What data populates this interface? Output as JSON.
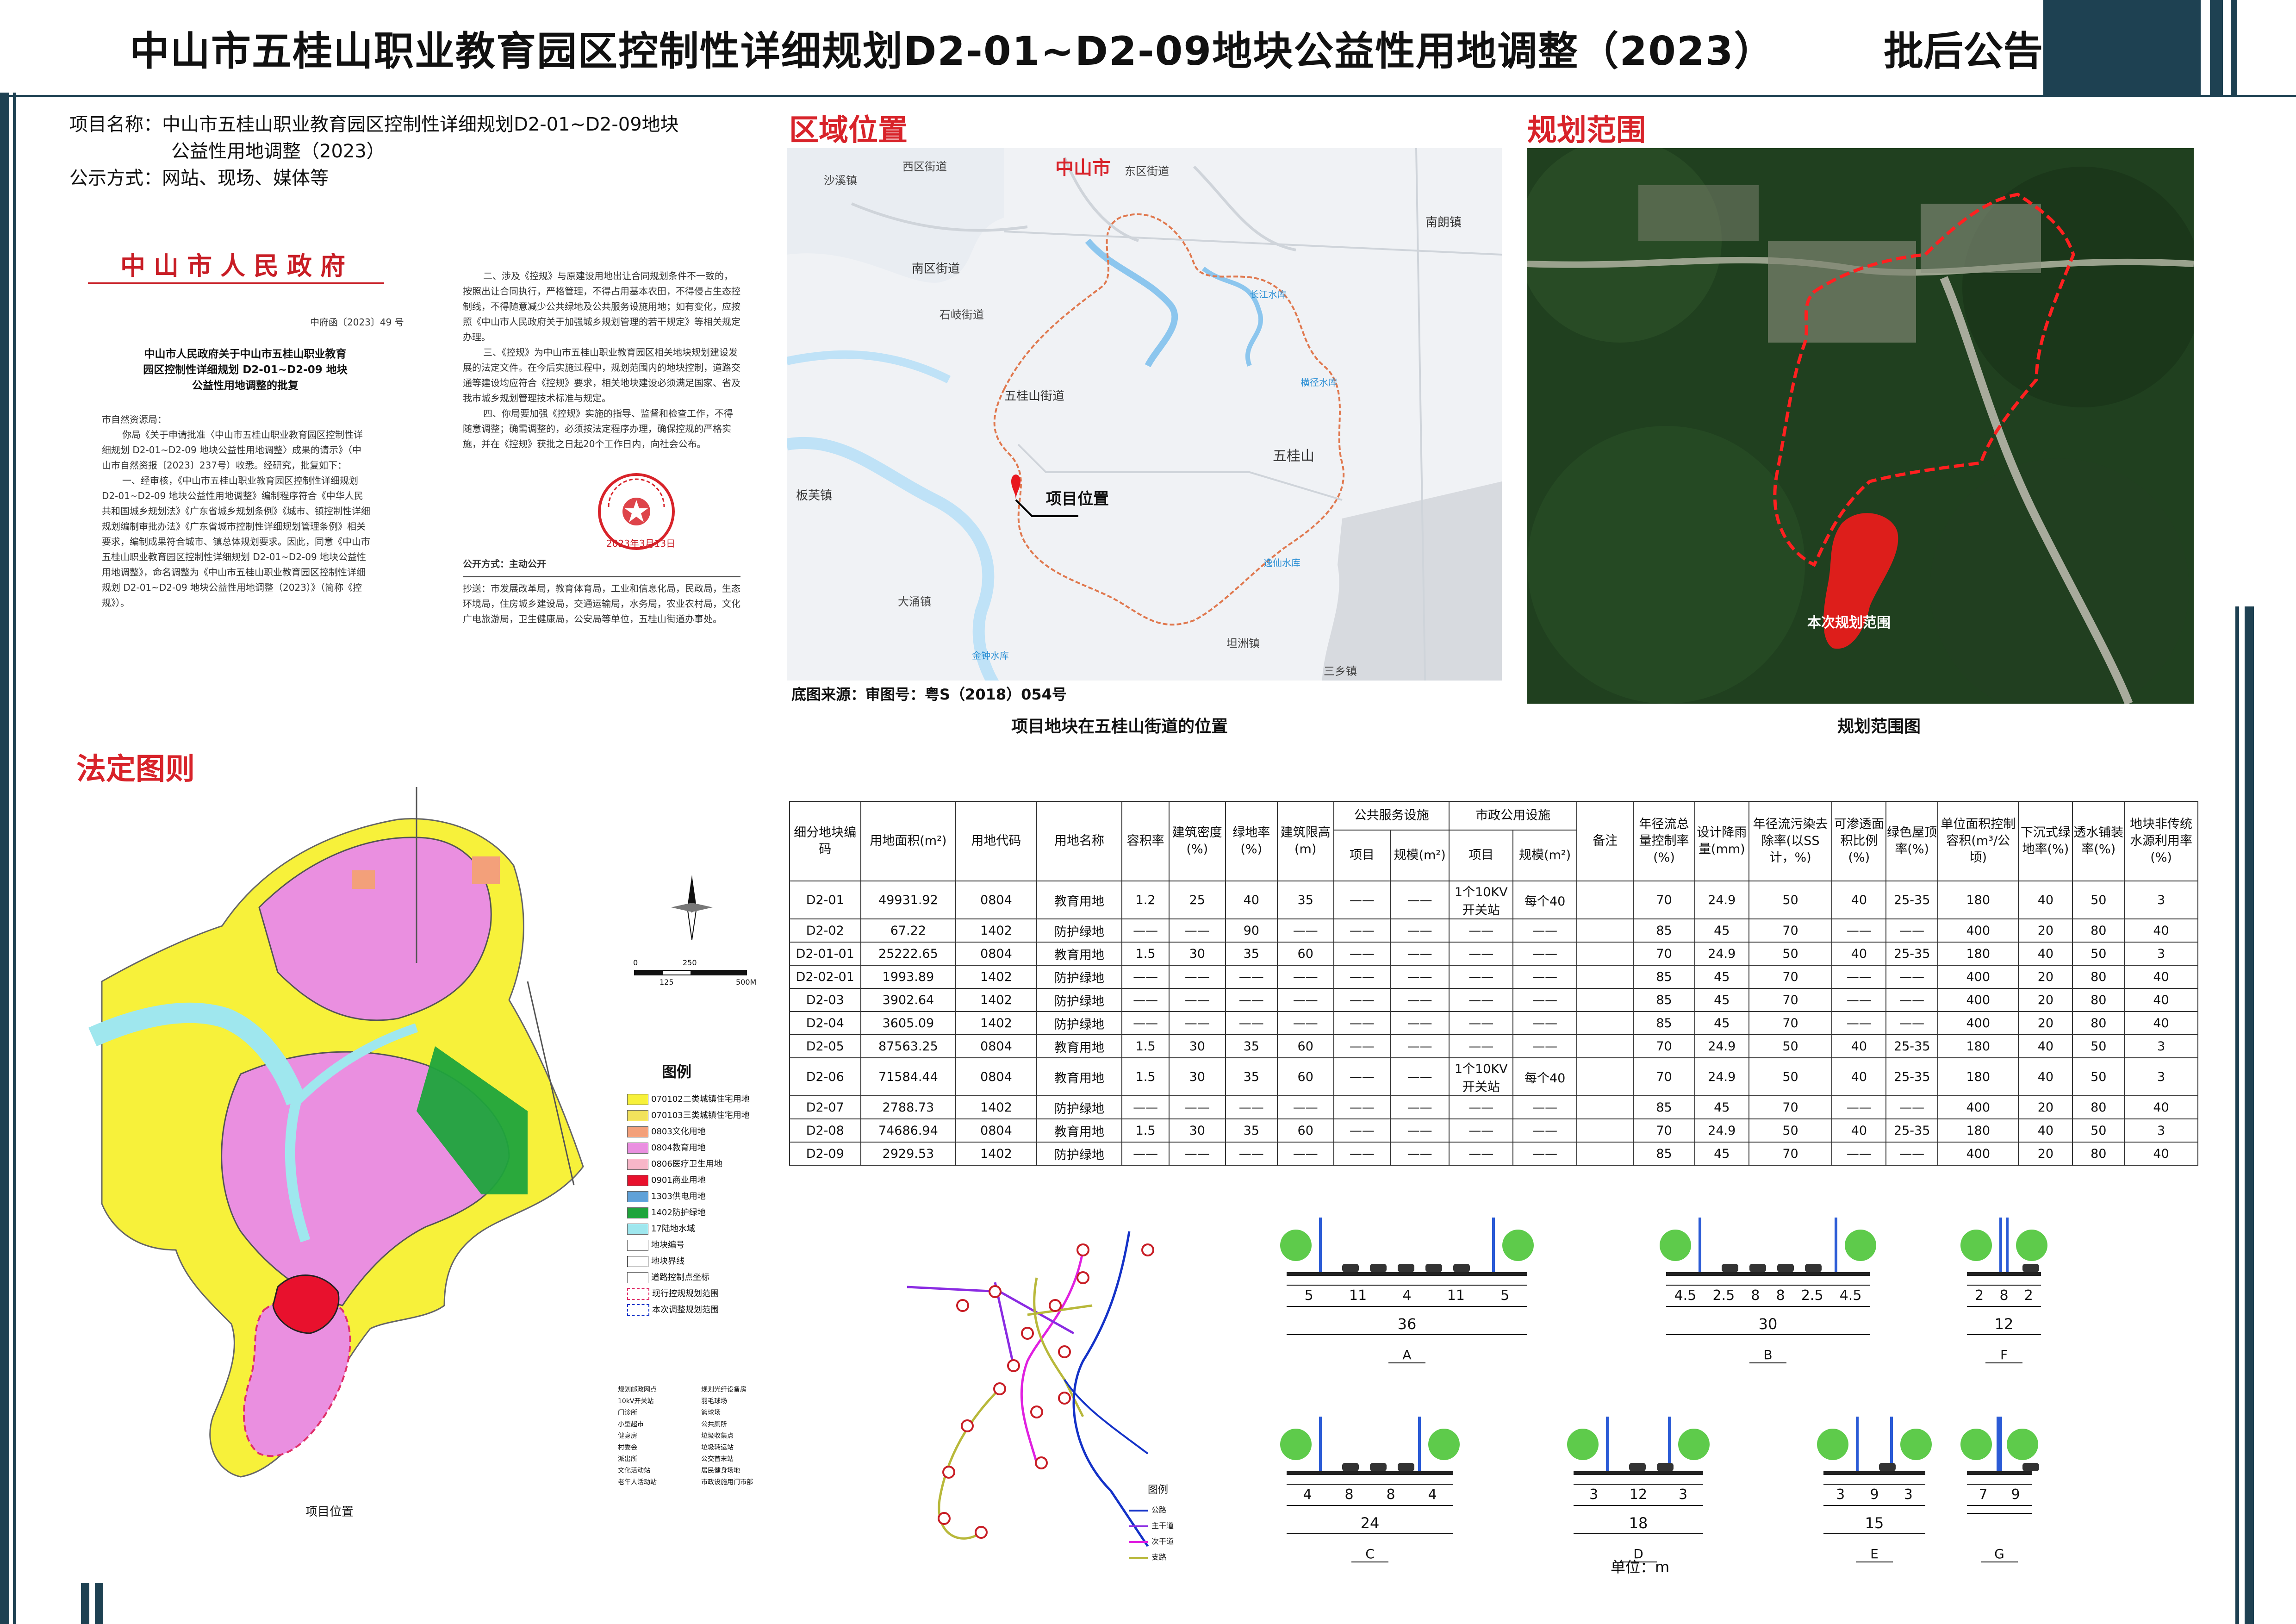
{
  "header": {
    "title": "中山市五桂山职业教育园区控制性详细规划D2-01~D2-09地块公益性用地调整（2023）",
    "notice": "批后公告"
  },
  "project": {
    "name_label": "项目名称：",
    "name_line1": "中山市五桂山职业教育园区控制性详细规划D2-01~D2-09地块",
    "name_line2": "公益性用地调整（2023）",
    "method_label": "公示方式：",
    "method": "网站、现场、媒体等"
  },
  "document": {
    "gov_title": "中山市人民政府",
    "doc_number": "中府函〔2023〕49 号",
    "doc_heading_1": "中山市人民政府关于中山市五桂山职业教育",
    "doc_heading_2": "园区控制性详细规划 D2-01~D2-09 地块",
    "doc_heading_3": "公益性用地调整的批复",
    "addressee": "市自然资源局：",
    "para1": "你局《关于申请批准〈中山市五桂山职业教育园区控制性详细规划 D2-01~D2-09 地块公益性用地调整〉成果的请示》（中山市自然资报〔2023〕237号）收悉。经研究，批复如下：",
    "para2": "一、经审核，《中山市五桂山职业教育园区控制性详细规划 D2-01~D2-09 地块公益性用地调整》编制程序符合《中华人民共和国城乡规划法》《广东省城乡规划条例》《城市、镇控制性详细规划编制审批办法》《广东省城市控制性详细规划管理条例》相关要求，编制成果符合城市、镇总体规划要求。因此，同意《中山市五桂山职业教育园区控制性详细规划 D2-01~D2-09 地块公益性用地调整》，命名调整为《中山市五桂山职业教育园区控制性详细规划 D2-01~D2-09 地块公益性用地调整（2023）》（简称《控规》）。",
    "para3": "二、涉及《控规》与原建设用地出让合同规划条件不一致的，按照出让合同执行，严格管理，不得占用基本农田，不得侵占生态控制线，不得随意减少公共绿地及公共服务设施用地；如有变化，应按照《中山市人民政府关于加强城乡规划管理的若干规定》等相关规定办理。",
    "para4": "三、《控规》为中山市五桂山职业教育园区相关地块规划建设发展的法定文件。在今后实施过程中，规划范围内的地块控制，道路交通等建设均应符合《控规》要求，相关地块建设必须满足国家、省及我市城乡规划管理技术标准与规定。",
    "para5": "四、你局要加强《控规》实施的指导、监督和检查工作，不得随意调整；确需调整的，必须按法定程序办理，确保控规的严格实施，并在《控规》获批之日起20个工作日内，向社会公布。",
    "seal_date": "2023年3月13日",
    "public_label": "公开方式：主动公开",
    "cc_label": "抄送：",
    "cc": "市发展改革局，教育体育局，工业和信息化局，民政局，生态环境局，住房城乡建设局，交通运输局，水务局，农业农村局，文化广电旅游局，卫生健康局，公安局等单位，五桂山街道办事处。"
  },
  "location": {
    "title": "区域位置",
    "caption": "项目地块在五桂山街道的位置",
    "source": "底图来源：审图号：粤S（2018）054号",
    "city_label": "中山市",
    "project_label": "项目位置",
    "labels": [
      "西区街道",
      "东区街道",
      "石岐街道",
      "沙溪镇",
      "南区街道",
      "五桂山街道",
      "南朗镇",
      "板芙镇",
      "大涌镇",
      "坦洲镇",
      "三乡镇",
      "五桂山",
      "长江水库",
      "金钟水库",
      "逸仙水库",
      "横径水库"
    ]
  },
  "scope": {
    "title": "规划范围",
    "caption": "规划范围图",
    "area_label": "本次规划范围"
  },
  "statutory": {
    "title": "法定图则",
    "project_label": "项目位置",
    "legend_title": "图例",
    "legend": [
      {
        "label": "070102二类城镇住宅用地",
        "color": "#f7f13a"
      },
      {
        "label": "070103三类城镇住宅用地",
        "color": "#f2e25c"
      },
      {
        "label": "0803文化用地",
        "color": "#f3a07a"
      },
      {
        "label": "0804教育用地",
        "color": "#ea8fe0"
      },
      {
        "label": "0806医疗卫生用地",
        "color": "#f7b6c8"
      },
      {
        "label": "0901商业用地",
        "color": "#e8112d"
      },
      {
        "label": "1303供电用地",
        "color": "#5fa1d8"
      },
      {
        "label": "1402防护绿地",
        "color": "#1fa43c"
      },
      {
        "label": "17陆地水域",
        "color": "#9fe7ee"
      },
      {
        "label": "地块编号",
        "color": "#ffffff"
      },
      {
        "label": "地块界线",
        "color": "#ffffff"
      },
      {
        "label": "道路控制点坐标",
        "color": "#ffffff"
      },
      {
        "label": "现行控规规划范围",
        "color": "#ffffff"
      },
      {
        "label": "本次调整规划范围",
        "color": "#ffffff"
      }
    ],
    "facilities": [
      "规划邮政网点",
      "10kV开关站",
      "门诊所",
      "小型超市",
      "健身房",
      "村委会",
      "派出所",
      "文化活动站",
      "老年人活动站",
      "规划光纤设备房",
      "羽毛球场",
      "篮球场",
      "公共厕所",
      "垃圾收集点",
      "垃圾转运站",
      "公交首末站",
      "居民健身场地",
      "市政设施用门市部"
    ],
    "scale_ticks": [
      "0",
      "125",
      "250",
      "500M"
    ]
  },
  "table": {
    "headers": {
      "code": "细分地块编码",
      "area": "用地面积(m²)",
      "usecode": "用地代码",
      "usename": "用地名称",
      "far": "容积率",
      "density": "建筑密度(%)",
      "green": "绿地率(%)",
      "height": "建筑限高(m)",
      "public": "公共服务设施",
      "municipal": "市政公用设施",
      "item": "项目",
      "scale": "规模(m²)",
      "note": "备注",
      "runoff": "年径流总量控制率(%)",
      "rain": "设计降雨量(mm)",
      "pollute": "年径流污染去除率(以SS计，%)",
      "permeable": "可渗透面积比例(%)",
      "roof": "绿色屋顶率(%)",
      "volume": "单位面积控制容积(m³/公顷)",
      "sunken": "下沉式绿地率(%)",
      "paving": "透水铺装率(%)",
      "nonconv": "地块非传统水源利用率(%)"
    },
    "rows": [
      [
        "D2-01",
        "49931.92",
        "0804",
        "教育用地",
        "1.2",
        "25",
        "40",
        "35",
        "——",
        "——",
        "1个10KV开关站",
        "每个40",
        "",
        "70",
        "24.9",
        "50",
        "40",
        "25-35",
        "180",
        "40",
        "50",
        "3"
      ],
      [
        "D2-02",
        "67.22",
        "1402",
        "防护绿地",
        "——",
        "——",
        "90",
        "——",
        "——",
        "——",
        "——",
        "——",
        "",
        "85",
        "45",
        "70",
        "——",
        "——",
        "400",
        "20",
        "80",
        "40"
      ],
      [
        "D2-01-01",
        "25222.65",
        "0804",
        "教育用地",
        "1.5",
        "30",
        "35",
        "60",
        "——",
        "——",
        "——",
        "——",
        "",
        "70",
        "24.9",
        "50",
        "40",
        "25-35",
        "180",
        "40",
        "50",
        "3"
      ],
      [
        "D2-02-01",
        "1993.89",
        "1402",
        "防护绿地",
        "——",
        "——",
        "——",
        "——",
        "——",
        "——",
        "——",
        "——",
        "",
        "85",
        "45",
        "70",
        "——",
        "——",
        "400",
        "20",
        "80",
        "40"
      ],
      [
        "D2-03",
        "3902.64",
        "1402",
        "防护绿地",
        "——",
        "——",
        "——",
        "——",
        "——",
        "——",
        "——",
        "——",
        "",
        "85",
        "45",
        "70",
        "——",
        "——",
        "400",
        "20",
        "80",
        "40"
      ],
      [
        "D2-04",
        "3605.09",
        "1402",
        "防护绿地",
        "——",
        "——",
        "——",
        "——",
        "——",
        "——",
        "——",
        "——",
        "",
        "85",
        "45",
        "70",
        "——",
        "——",
        "400",
        "20",
        "80",
        "40"
      ],
      [
        "D2-05",
        "87563.25",
        "0804",
        "教育用地",
        "1.5",
        "30",
        "35",
        "60",
        "——",
        "——",
        "——",
        "——",
        "",
        "70",
        "24.9",
        "50",
        "40",
        "25-35",
        "180",
        "40",
        "50",
        "3"
      ],
      [
        "D2-06",
        "71584.44",
        "0804",
        "教育用地",
        "1.5",
        "30",
        "35",
        "60",
        "——",
        "——",
        "1个10KV开关站",
        "每个40",
        "",
        "70",
        "24.9",
        "50",
        "40",
        "25-35",
        "180",
        "40",
        "50",
        "3"
      ],
      [
        "D2-07",
        "2788.73",
        "1402",
        "防护绿地",
        "——",
        "——",
        "——",
        "——",
        "——",
        "——",
        "——",
        "——",
        "",
        "85",
        "45",
        "70",
        "——",
        "——",
        "400",
        "20",
        "80",
        "40"
      ],
      [
        "D2-08",
        "74686.94",
        "0804",
        "教育用地",
        "1.5",
        "30",
        "35",
        "60",
        "——",
        "——",
        "——",
        "——",
        "",
        "70",
        "24.9",
        "50",
        "40",
        "25-35",
        "180",
        "40",
        "50",
        "3"
      ],
      [
        "D2-09",
        "2929.53",
        "1402",
        "防护绿地",
        "——",
        "——",
        "——",
        "——",
        "——",
        "——",
        "——",
        "——",
        "",
        "85",
        "45",
        "70",
        "——",
        "——",
        "400",
        "20",
        "80",
        "40"
      ]
    ]
  },
  "roads": {
    "unit": "单位：m",
    "legend_title": "图例",
    "legend": [
      {
        "label": "公路",
        "color": "#1432c8"
      },
      {
        "label": "主干道",
        "color": "#8a2be2"
      },
      {
        "label": "次干道",
        "color": "#e020e0"
      },
      {
        "label": "支路",
        "color": "#b8b83a"
      }
    ],
    "sections": [
      {
        "name": "A",
        "dims": [
          "5",
          "11",
          "4",
          "11",
          "5"
        ],
        "total": "36"
      },
      {
        "name": "B",
        "dims": [
          "4.5",
          "2.5",
          "8",
          "8",
          "2.5",
          "4.5"
        ],
        "total": "30"
      },
      {
        "name": "F",
        "dims": [
          "2",
          "8",
          "2"
        ],
        "total": "12"
      },
      {
        "name": "C",
        "dims": [
          "4",
          "8",
          "8",
          "4"
        ],
        "total": "24"
      },
      {
        "name": "D",
        "dims": [
          "3",
          "12",
          "3"
        ],
        "total": "18"
      },
      {
        "name": "E",
        "dims": [
          "3",
          "9",
          "3"
        ],
        "total": "15"
      },
      {
        "name": "G",
        "dims": [
          "7",
          "9"
        ],
        "total": ""
      }
    ]
  }
}
